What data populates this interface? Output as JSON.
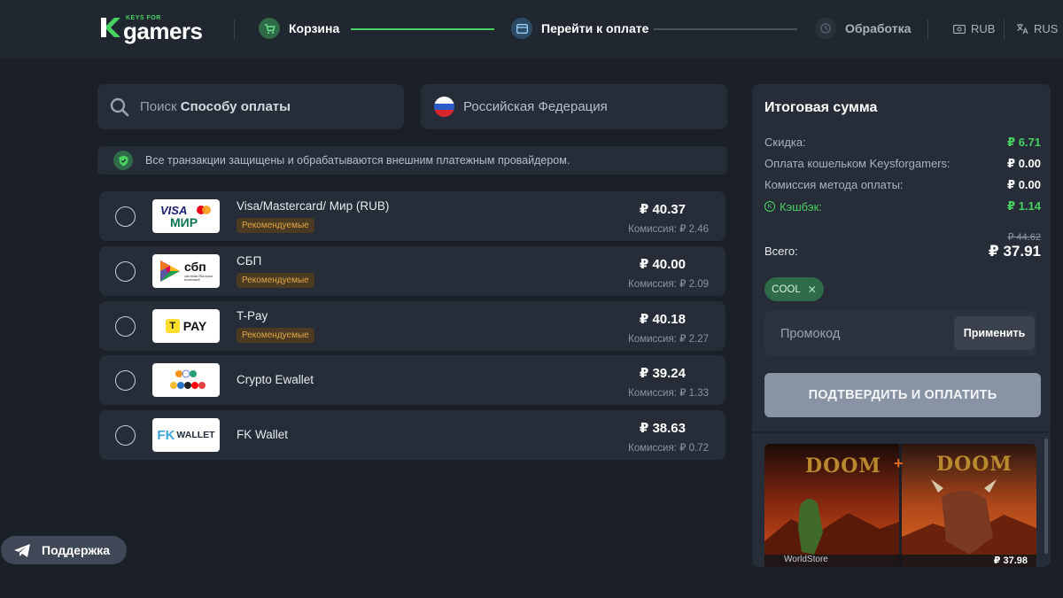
{
  "header": {
    "logo_small": "KEYS FOR",
    "logo_big": "gamers",
    "steps": [
      {
        "label": "Корзина",
        "state": "done"
      },
      {
        "label": "Перейти к оплате",
        "state": "current"
      },
      {
        "label": "Обработка",
        "state": "pending"
      }
    ],
    "currency": "RUB",
    "language": "RUS"
  },
  "search": {
    "prefix": "Поиск",
    "bold": "Способу оплаты"
  },
  "country": "Российская Федерация",
  "security_note": "Все транзакции защищены и обрабатываются внешним платежным провайдером.",
  "methods": [
    {
      "name": "Visa/Mastercard/ Мир (RUB)",
      "badge": "Рекомендуемые",
      "price": "₽ 40.37",
      "fee": "Комиссия: ₽ 2.46",
      "logo": "visa-mir-logo"
    },
    {
      "name": "СБП",
      "badge": "Рекомендуемые",
      "price": "₽ 40.00",
      "fee": "Комиссия: ₽ 2.09",
      "logo": "sbp-logo"
    },
    {
      "name": "T-Pay",
      "badge": "Рекомендуемые",
      "price": "₽ 40.18",
      "fee": "Комиссия: ₽ 2.27",
      "logo": "tpay-logo"
    },
    {
      "name": "Crypto Ewallet",
      "badge": "",
      "price": "₽ 39.24",
      "fee": "Комиссия: ₽ 1.33",
      "logo": "crypto-logo"
    },
    {
      "name": "FK Wallet",
      "badge": "",
      "price": "₽ 38.63",
      "fee": "Комиссия: ₽ 0.72",
      "logo": "fk-wallet-logo"
    }
  ],
  "logos": {
    "visa": "VISA",
    "mir": "МИР",
    "sbp": "сбп",
    "sbp_sub": "система быстрых платежей",
    "tpay": "PAY",
    "tpay_t": "T",
    "fk": "FK",
    "wallet": "WALLET"
  },
  "summary": {
    "title": "Итоговая сумма",
    "discount_label": "Скидка:",
    "discount_value": "₽ 6.71",
    "wallet_label": "Оплата кошельком Keysforgamers:",
    "wallet_value": "₽ 0.00",
    "fee_label": "Комиссия метода оплаты:",
    "fee_value": "₽ 0.00",
    "cashback_label": "Кэшбэк:",
    "cashback_value": "₽ 1.14",
    "old_total": "₽ 44.62",
    "total_label": "Всего:",
    "total_value": "₽ 37.91",
    "coupon": "COOL",
    "promo_placeholder": "Промокод",
    "apply_label": "Применить",
    "confirm_label": "ПОДТВЕРДИТЬ И ОПЛАТИТЬ"
  },
  "game": {
    "seller": "WorldStore",
    "price": "₽ 37.98",
    "title_left": "DOOM",
    "title_right": "DOOM",
    "plus": "+"
  },
  "support_label": "Поддержка",
  "colors": {
    "accent_green": "#46d160",
    "badge_text": "#e0a548",
    "bg": "#1b2028",
    "panel": "#262d38"
  }
}
